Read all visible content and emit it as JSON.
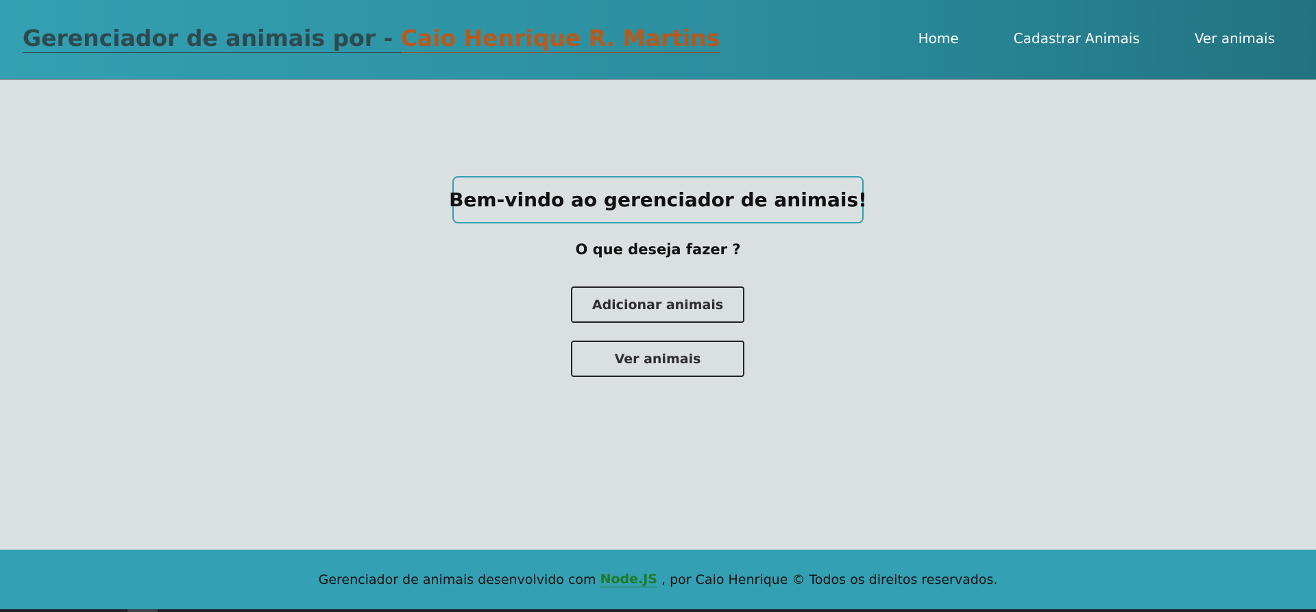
{
  "header": {
    "brand_prefix": "Gerenciador de animais por - ",
    "brand_name": "Caio Henrique R. Martins",
    "nav": [
      {
        "label": "Home"
      },
      {
        "label": "Cadastrar Animais"
      },
      {
        "label": "Ver animais"
      }
    ]
  },
  "main": {
    "welcome": "Bem-vindo ao gerenciador de animais!",
    "question": "O que deseja fazer ?",
    "add_button": "Adicionar animais",
    "view_button": "Ver animais"
  },
  "footer": {
    "text_before": "Gerenciador de animais desenvolvido com ",
    "link": "Node.JS",
    "text_after": " , por Caio Henrique © Todos os direitos reservados."
  },
  "colors": {
    "header_gradient_start": "#33a0b3",
    "header_gradient_end": "#227381",
    "brand_name": "#b85a1c",
    "background": "#dae0e0",
    "footer": "#33a0b3",
    "footer_link": "#1e7a26"
  }
}
